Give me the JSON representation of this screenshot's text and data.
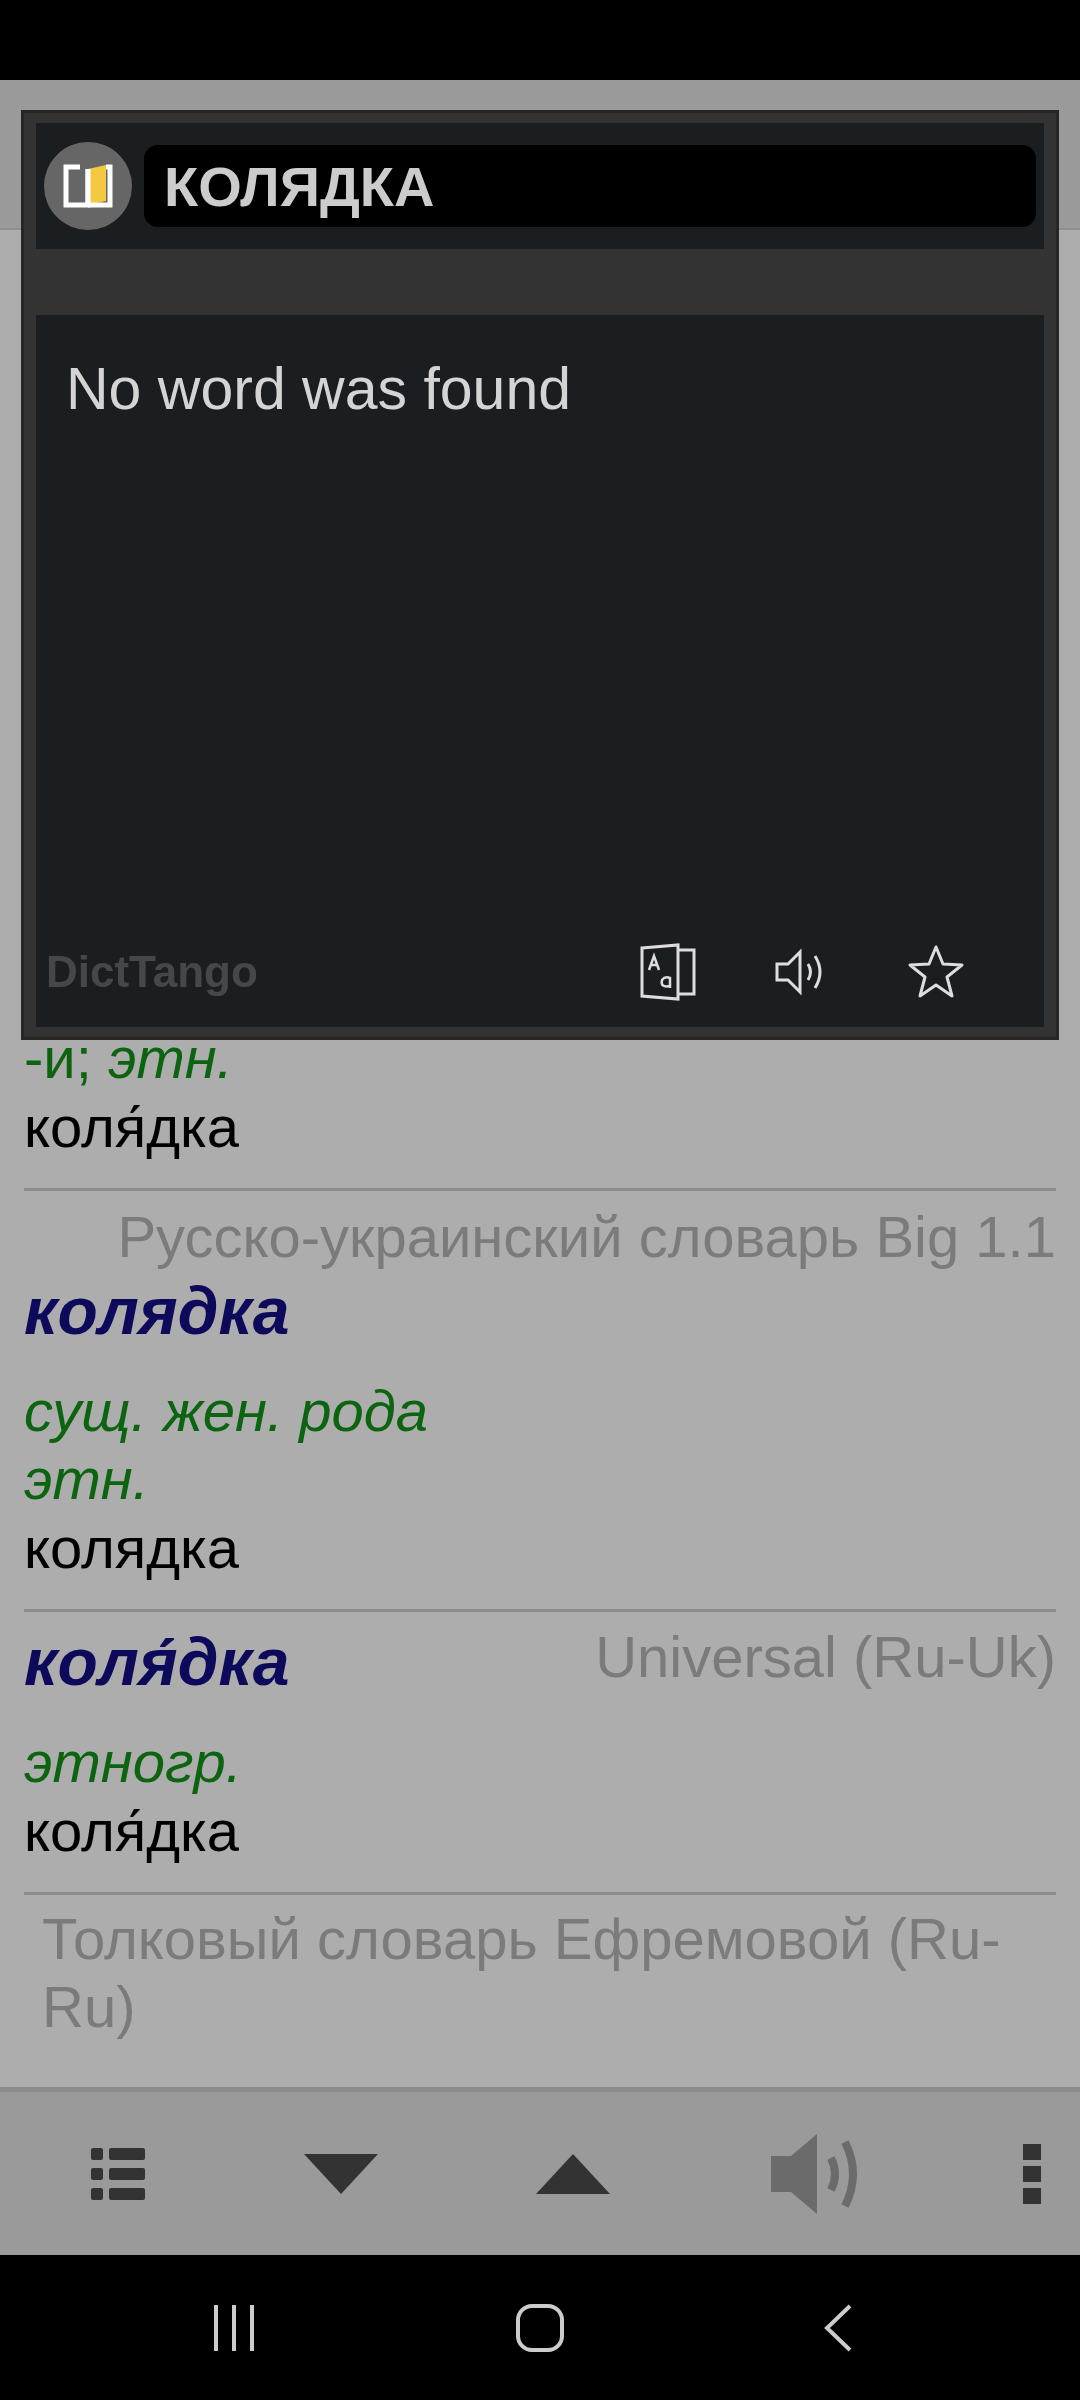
{
  "popup": {
    "title": "КОЛЯДКА",
    "message": "No word was found",
    "brand": "DictTango",
    "actions": [
      {
        "kind": "translate"
      },
      {
        "kind": "speaker"
      },
      {
        "kind": "star",
        "favorite": false
      }
    ]
  },
  "entries": [
    {
      "kind": "plain",
      "grammar": [
        "-и; *этн.*"
      ],
      "translation": "коля́дка"
    },
    {
      "kind": "source-above",
      "source": "Русско-украинский словарь Big 1.1",
      "headword": "колядка",
      "grammar": [
        "сущ. жен. рода",
        "этн."
      ],
      "translation": "колядка"
    },
    {
      "kind": "source-inline",
      "source": "Universal (Ru-Uk)",
      "headword": "коля́дка",
      "grammar": [
        "этногр."
      ],
      "translation": "коля́дка"
    },
    {
      "kind": "source-only",
      "source": "Толковый словарь Ефремовой (Ru-Ru)"
    }
  ],
  "toolbar": [
    {
      "kind": "list",
      "disabled": false
    },
    {
      "kind": "down",
      "disabled": false
    },
    {
      "kind": "up",
      "disabled": false
    },
    {
      "kind": "speaker",
      "disabled": true
    },
    {
      "kind": "more",
      "disabled": false
    }
  ],
  "nav": [
    {
      "kind": "recents"
    },
    {
      "kind": "home"
    },
    {
      "kind": "back"
    }
  ]
}
